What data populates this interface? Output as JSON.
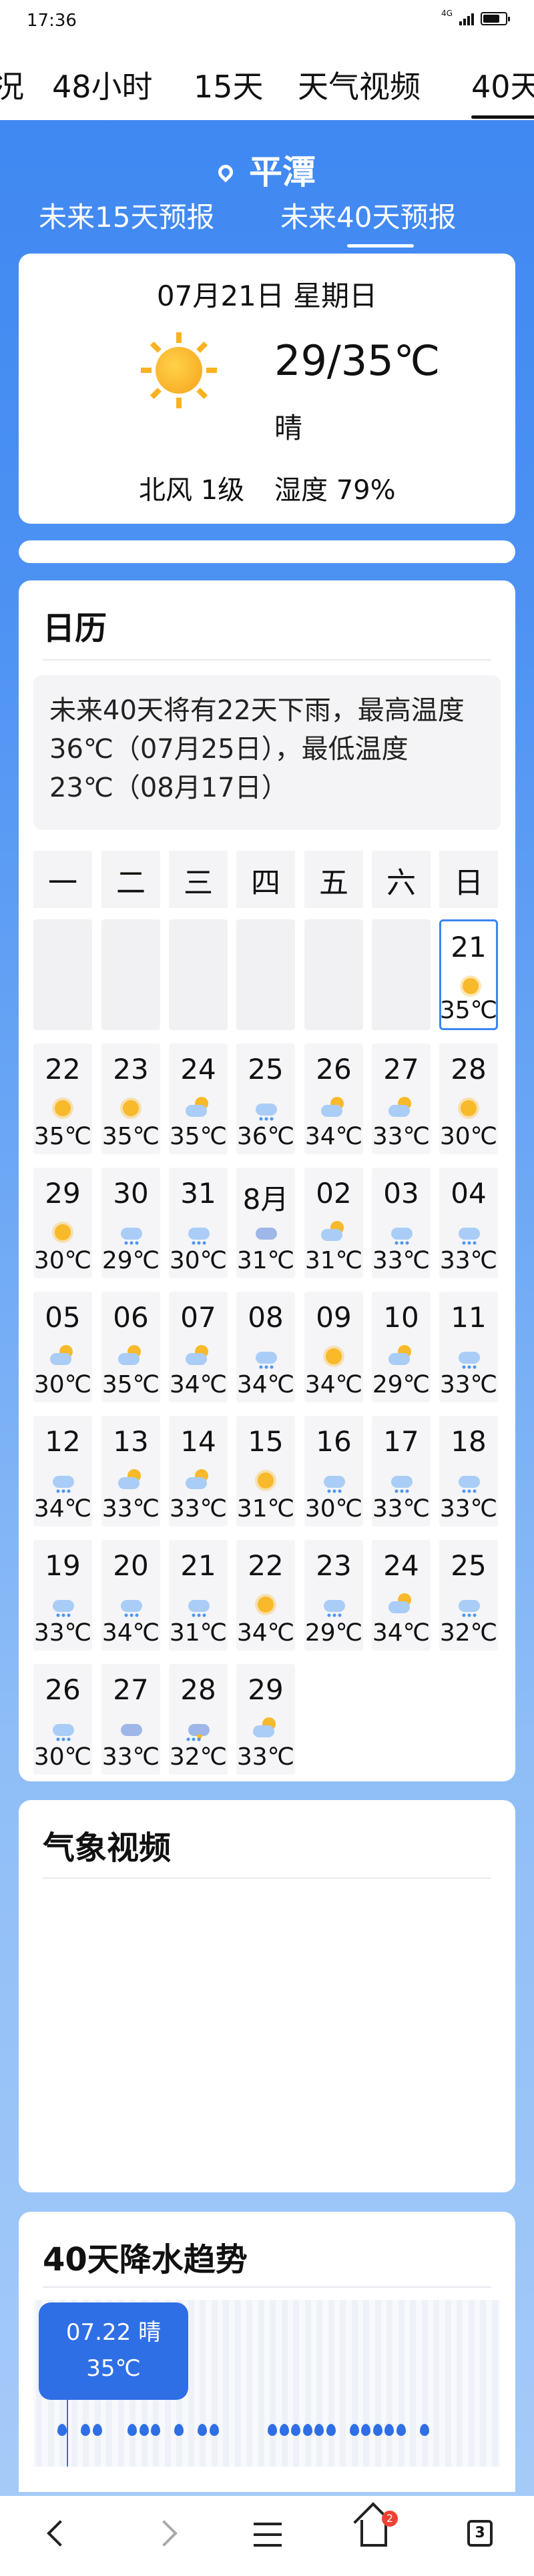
{
  "status": {
    "time": "17:36",
    "network": "4G",
    "battery_level": 0.75
  },
  "tabs": [
    {
      "label": "况"
    },
    {
      "label": "48小时"
    },
    {
      "label": "15天"
    },
    {
      "label": "天气视频"
    },
    {
      "label": "40天",
      "active": true
    }
  ],
  "city": "平潭",
  "subtabs": [
    {
      "label": "未来15天预报"
    },
    {
      "label": "未来40天预报",
      "active": true
    }
  ],
  "today": {
    "date": "07月21日 星期日",
    "temp": "29/35℃",
    "condition": "晴",
    "icon": "sun-icon",
    "wind": "北风 1级",
    "humidity": "湿度 79%"
  },
  "calendar": {
    "title": "日历",
    "summary": "未来40天将有22天下雨，最高温度36℃（07月25日），最低温度23℃（08月17日）",
    "weekdays": [
      "一",
      "二",
      "三",
      "四",
      "五",
      "六",
      "日"
    ],
    "leading_blanks": 6,
    "days": [
      {
        "label": "21",
        "temp": "35℃",
        "icon": "sun",
        "today": true
      },
      {
        "label": "22",
        "temp": "35℃",
        "icon": "sun"
      },
      {
        "label": "23",
        "temp": "35℃",
        "icon": "sun"
      },
      {
        "label": "24",
        "temp": "35℃",
        "icon": "partly"
      },
      {
        "label": "25",
        "temp": "36℃",
        "icon": "rain"
      },
      {
        "label": "26",
        "temp": "34℃",
        "icon": "partly"
      },
      {
        "label": "27",
        "temp": "33℃",
        "icon": "partly"
      },
      {
        "label": "28",
        "temp": "30℃",
        "icon": "sun"
      },
      {
        "label": "29",
        "temp": "30℃",
        "icon": "sun"
      },
      {
        "label": "30",
        "temp": "29℃",
        "icon": "rain"
      },
      {
        "label": "31",
        "temp": "30℃",
        "icon": "rain"
      },
      {
        "label": "8月",
        "temp": "31℃",
        "icon": "cloud"
      },
      {
        "label": "02",
        "temp": "31℃",
        "icon": "partly"
      },
      {
        "label": "03",
        "temp": "33℃",
        "icon": "rain"
      },
      {
        "label": "04",
        "temp": "33℃",
        "icon": "rain"
      },
      {
        "label": "05",
        "temp": "30℃",
        "icon": "partly"
      },
      {
        "label": "06",
        "temp": "35℃",
        "icon": "partly"
      },
      {
        "label": "07",
        "temp": "34℃",
        "icon": "partly"
      },
      {
        "label": "08",
        "temp": "34℃",
        "icon": "rain"
      },
      {
        "label": "09",
        "temp": "34℃",
        "icon": "sun"
      },
      {
        "label": "10",
        "temp": "29℃",
        "icon": "partly"
      },
      {
        "label": "11",
        "temp": "33℃",
        "icon": "rain"
      },
      {
        "label": "12",
        "temp": "34℃",
        "icon": "rain"
      },
      {
        "label": "13",
        "temp": "33℃",
        "icon": "partly"
      },
      {
        "label": "14",
        "temp": "33℃",
        "icon": "partly"
      },
      {
        "label": "15",
        "temp": "31℃",
        "icon": "sun"
      },
      {
        "label": "16",
        "temp": "30℃",
        "icon": "rain"
      },
      {
        "label": "17",
        "temp": "33℃",
        "icon": "rain"
      },
      {
        "label": "18",
        "temp": "33℃",
        "icon": "rain"
      },
      {
        "label": "19",
        "temp": "33℃",
        "icon": "rain"
      },
      {
        "label": "20",
        "temp": "34℃",
        "icon": "rain"
      },
      {
        "label": "21",
        "temp": "31℃",
        "icon": "rain"
      },
      {
        "label": "22",
        "temp": "34℃",
        "icon": "sun"
      },
      {
        "label": "23",
        "temp": "29℃",
        "icon": "rain"
      },
      {
        "label": "24",
        "temp": "34℃",
        "icon": "partly"
      },
      {
        "label": "25",
        "temp": "32℃",
        "icon": "rain"
      },
      {
        "label": "26",
        "temp": "30℃",
        "icon": "rain"
      },
      {
        "label": "27",
        "temp": "33℃",
        "icon": "cloud"
      },
      {
        "label": "28",
        "temp": "32℃",
        "icon": "thunder"
      },
      {
        "label": "29",
        "temp": "33℃",
        "icon": "partly"
      }
    ]
  },
  "video": {
    "title": "气象视频"
  },
  "precip": {
    "title": "40天降水趋势",
    "tooltip_date": "07.22 晴",
    "tooltip_temp": "35℃",
    "bars": 40,
    "rain_days": [
      2,
      4,
      5,
      8,
      9,
      10,
      12,
      14,
      15,
      20,
      21,
      22,
      23,
      24,
      25,
      27,
      28,
      29,
      30,
      31,
      33
    ]
  },
  "nav": {
    "badge_count": "2",
    "tab_count": "3"
  },
  "colors": {
    "accent": "#3a86f0",
    "sun": "#f8b92a",
    "rain": "#4f95ef"
  }
}
